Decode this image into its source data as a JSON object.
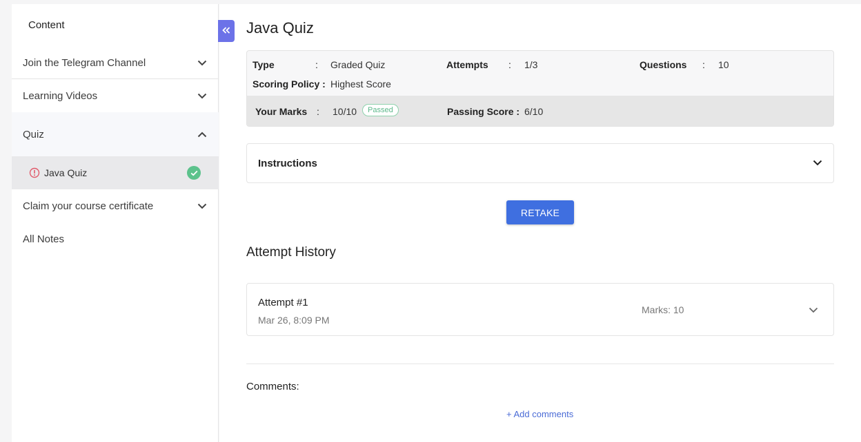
{
  "sidebar": {
    "title": "Content",
    "items": [
      {
        "label": "Join the Telegram Channel",
        "icon": "chevron-down-icon"
      },
      {
        "label": "Learning Videos",
        "icon": "chevron-down-icon"
      },
      {
        "label": "Quiz",
        "icon": "chevron-up-icon"
      },
      {
        "label": "Claim your course certificate",
        "icon": "chevron-down-icon"
      },
      {
        "label": "All Notes"
      }
    ],
    "quiz_sub_item": {
      "label": "Java Quiz",
      "status_icon": "check-circle-icon",
      "status_color": "#5cc28c"
    }
  },
  "collapse_button": {
    "icon": "double-chevron-left-icon",
    "color": "#6c72e8"
  },
  "main": {
    "title": "Java Quiz",
    "info": {
      "type_label": "Type",
      "type_value": "Graded Quiz",
      "attempts_label": "Attempts",
      "attempts_value": "1/3",
      "questions_label": "Questions",
      "questions_value": "10",
      "scoring_label": "Scoring Policy :",
      "scoring_value": "Highest Score",
      "marks_label": "Your Marks",
      "marks_value": "10/10",
      "marks_badge": "Passed",
      "passing_label": "Passing Score :",
      "passing_value": "6/10",
      "colon": ":"
    },
    "instructions_label": "Instructions",
    "retake_label": "RETAKE",
    "retake_color": "#3f6fe0",
    "history_title": "Attempt History",
    "attempts": [
      {
        "name": "Attempt #1",
        "date": "Mar 26, 8:09 PM",
        "marks": "Marks: 10"
      }
    ],
    "comments_label": "Comments:",
    "add_comments_label": "+ Add comments"
  }
}
